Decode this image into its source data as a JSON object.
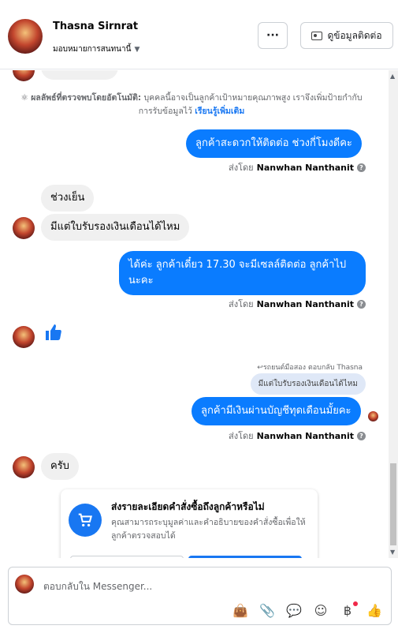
{
  "header": {
    "name": "Thasna Sirnrat",
    "assign_label": "มอบหมายการสนทนานี้",
    "more_label": "···",
    "contact_label": "ดูข้อมูลติดต่อ"
  },
  "auto_note": {
    "label": "ผลลัพธ์ที่ตรวจพบโดยอัตโนมัติ:",
    "text": "บุคคลนี้อาจเป็นลูกค้าเป้าหมายคุณภาพสูง เราจึงเพิ่มป้ายกำกับการรับข้อมูลไว้",
    "link": "เรียนรู้เพิ่มเติม"
  },
  "messages": {
    "m1": "ลูกค้าสะดวกให้ติดต่อ ช่วงกี่โมงดีคะ",
    "m2": "ช่วงเย็น",
    "m3": "มีแต่ใบรับรองเงินเดือนได้ไหม",
    "m4": "ได้ค่ะ ลูกค้าเดี๋ยว 17.30 จะมีเซลล์ติดต่อ ลูกค้าไปนะคะ",
    "reply_note": "↩รถยนต์มือสอง ตอบกลับ Thasna",
    "reply_quote": "มีแต่ใบรับรองเงินเดือนได้ไหม",
    "m5": "ลูกค้ามีเงินผ่านบัญชีทุดเดือนมั้ยคะ",
    "m6": "ครับ"
  },
  "sent_by": {
    "prefix": "ส่งโดย",
    "name": "Nanwhan Nanthanit"
  },
  "card": {
    "title": "ส่งรายละเอียดคำสั่งซื้อถึงลูกค้าหรือไม่",
    "desc": "คุณสามารถระบุมูลค่าและคำอธิบายของคำสั่งซื้อเพื่อให้ลูกค้าตรวจสอบได้"
  },
  "composer": {
    "placeholder": "ตอบกลับใน Messenger..."
  }
}
